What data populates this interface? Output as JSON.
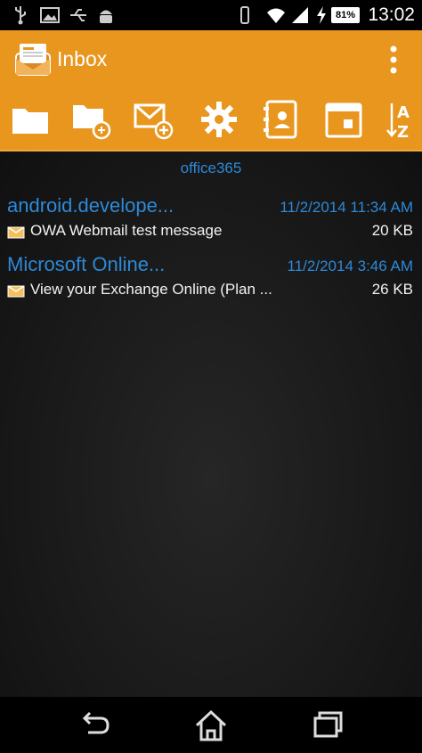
{
  "status_bar": {
    "time": "13:02",
    "battery": "81%",
    "icons": [
      "usb-icon",
      "image-icon",
      "usb-debug-icon",
      "android-icon",
      "vibrate-icon",
      "wifi-icon",
      "signal-icon",
      "charging-icon"
    ]
  },
  "action_bar": {
    "title": "Inbox",
    "accent_color": "#e8961e"
  },
  "toolbar": {
    "buttons": [
      "folder-icon",
      "folder-settings-icon",
      "compose-mail-icon",
      "settings-gear-icon",
      "contacts-icon",
      "calendar-icon",
      "sort-az-icon"
    ]
  },
  "account": "office365",
  "messages": [
    {
      "sender": "android.develope...",
      "date": "11/2/2014 11:34 AM",
      "subject": "OWA Webmail test message",
      "size": "20 KB"
    },
    {
      "sender": "Microsoft Online...",
      "date": "11/2/2014 3:46 AM",
      "subject": "View your Exchange Online (Plan ...",
      "size": "26 KB"
    }
  ],
  "nav_bar": {
    "buttons": [
      "back-icon",
      "home-icon",
      "recents-icon"
    ]
  },
  "colors": {
    "link_blue": "#2d89d8",
    "background": "#141414"
  }
}
